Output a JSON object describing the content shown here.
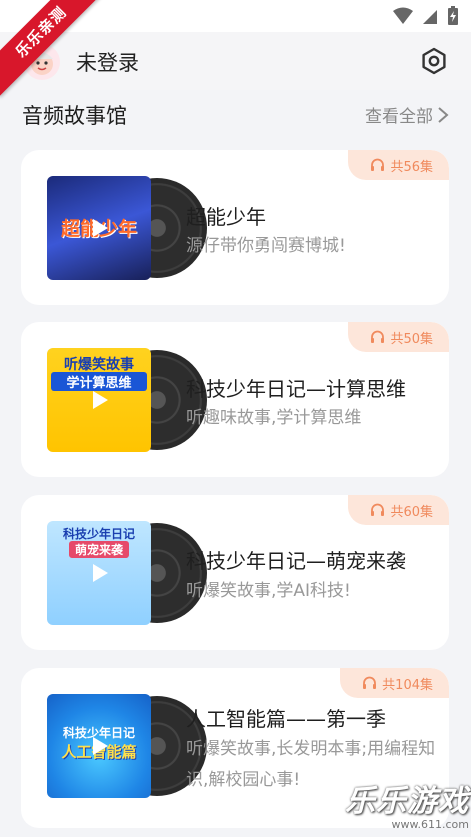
{
  "ribbon": {
    "text": "乐乐亲测"
  },
  "header": {
    "login_status": "未登录"
  },
  "section": {
    "title": "音频故事馆",
    "view_all": "查看全部"
  },
  "cards": [
    {
      "episodes": "共56集",
      "title": "超能少年",
      "desc": "源仔带你勇闯赛博城!",
      "cover_text": "超能少年",
      "cover_sub": "超能少年"
    },
    {
      "episodes": "共50集",
      "title": "科技少年日记—计算思维",
      "desc": "听趣味故事,学计算思维",
      "cover_text": "听爆笑故事",
      "cover_sub": "学计算思维"
    },
    {
      "episodes": "共60集",
      "title": "科技少年日记—萌宠来袭",
      "desc": "听爆笑故事,学AI科技!",
      "cover_text": "科技少年日记",
      "cover_sub": "萌宠来袭"
    },
    {
      "episodes": "共104集",
      "title": "人工智能篇——第一季",
      "desc": "听爆笑故事,长发明本事;用编程知识,解校园心事!",
      "cover_text": "科技少年日记",
      "cover_sub": "人工智能篇"
    }
  ],
  "watermark": {
    "brand": "乐乐游戏",
    "url": "www.611.com"
  },
  "colors": {
    "accent": "#f08a5d",
    "badge_bg": "#fde6da",
    "ribbon": "#d8172b"
  }
}
